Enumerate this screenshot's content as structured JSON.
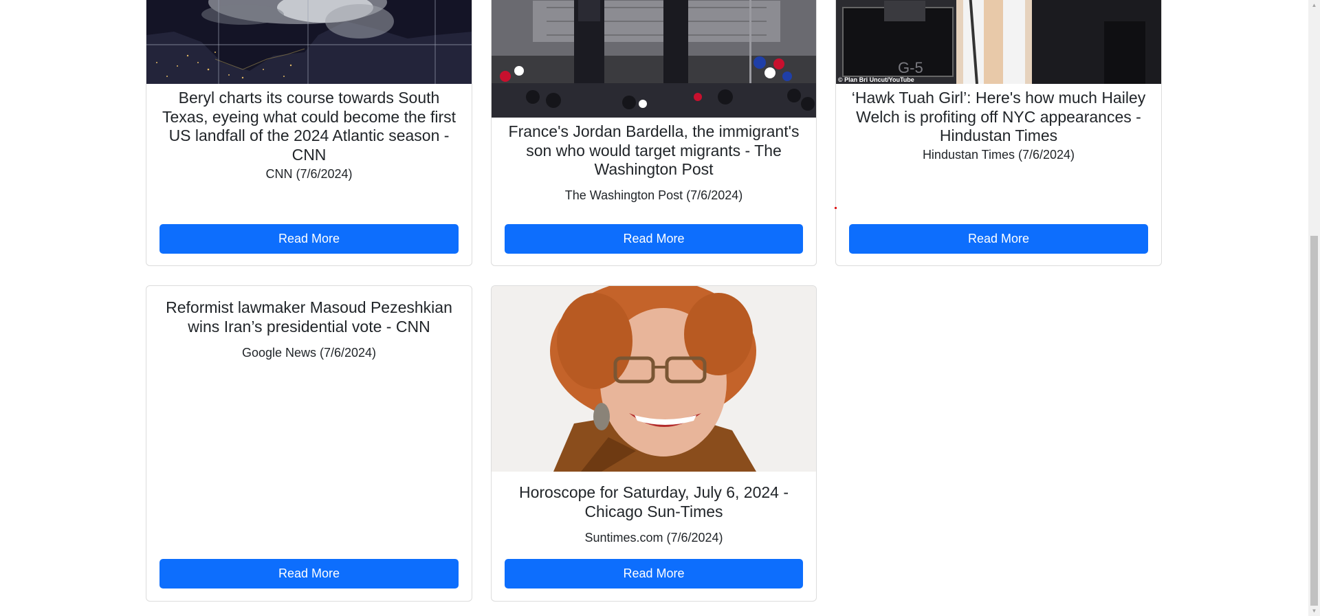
{
  "articles": [
    {
      "title": "Beryl charts its course towards South Texas, eyeing what could become the first US landfall of the 2024 Atlantic season - CNN",
      "source": "CNN (7/6/2024)",
      "button": "Read More",
      "image": "satellite-hurricane-map"
    },
    {
      "title": "France's Jordan Bardella, the immigrant's son who would target migrants - The Washington Post",
      "source": "The Washington Post (7/6/2024)",
      "button": "Read More",
      "image": "rally-stage-photo"
    },
    {
      "title": "‘Hawk Tuah Girl’: Here's how much Hailey Welch is profiting off NYC appearances - Hindustan Times",
      "source": "Hindustan Times (7/6/2024)",
      "button": "Read More",
      "image": "podcast-studio-photo",
      "image_credit": "© Plan Bri Uncut/YouTube"
    },
    {
      "title": "Reformist lawmaker Masoud Pezeshkian wins Iran’s presidential vote - CNN",
      "source": "Google News (7/6/2024)",
      "button": "Read More"
    },
    {
      "title": "Horoscope for Saturday, July 6, 2024 - Chicago Sun-Times",
      "source": "Suntimes.com (7/6/2024)",
      "button": "Read More",
      "image": "smiling-woman-portrait"
    }
  ],
  "colors": {
    "button_bg": "#0d6efd",
    "card_border": "#dcdcdc",
    "text": "#212529"
  }
}
